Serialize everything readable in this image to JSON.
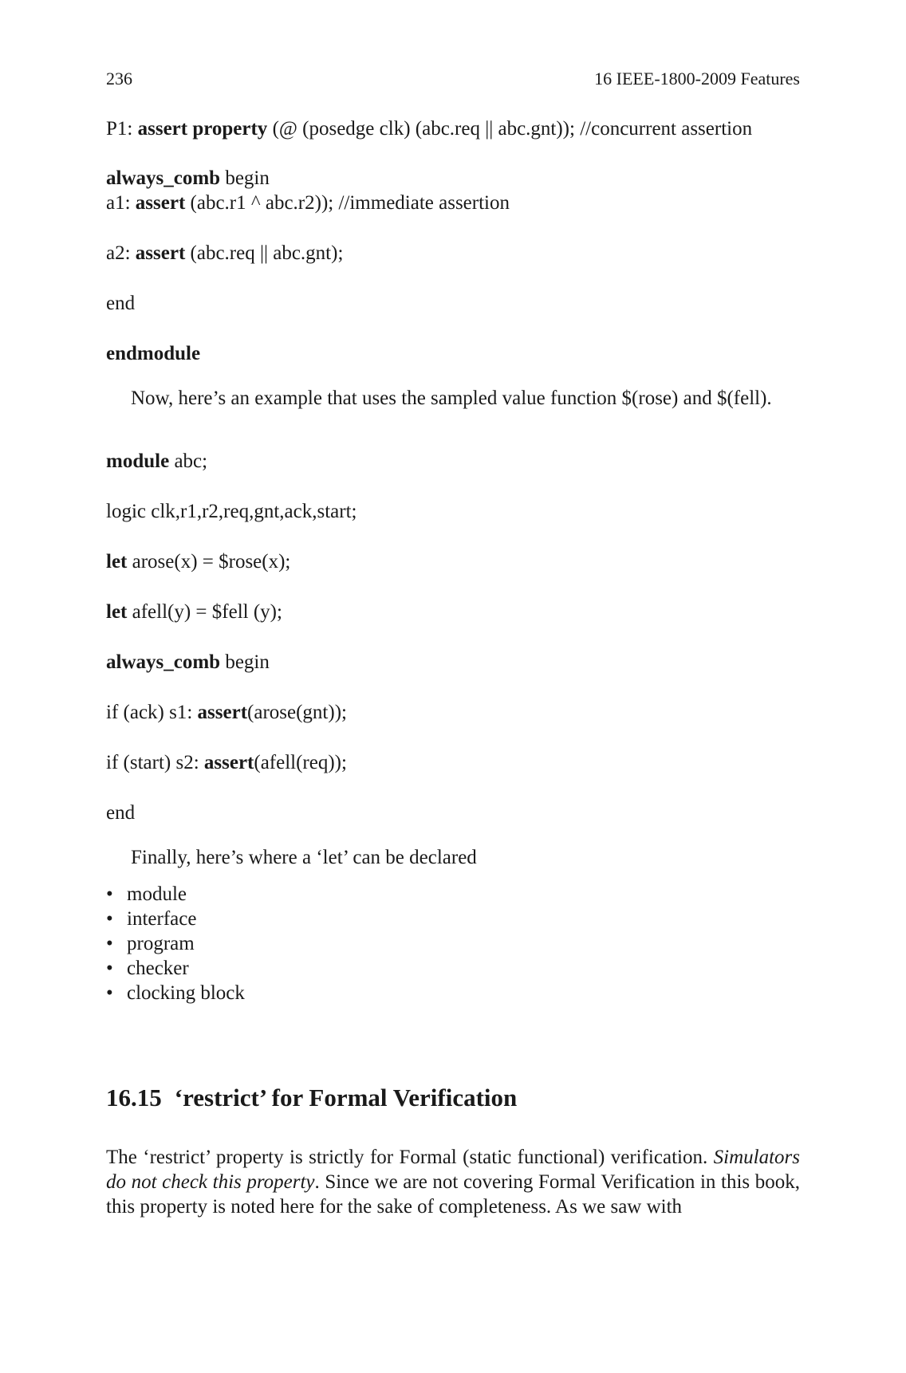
{
  "header": {
    "page_number": "236",
    "chapter": "16   IEEE-1800-2009 Features"
  },
  "code1": {
    "p1_label": "P1: ",
    "p1_kw": "assert property",
    "p1_rest": " (@ (posedge clk) (abc.req || abc.gnt)); //concurrent assertion",
    "always_kw": "always_comb",
    "always_rest": " begin",
    "a1_label": "a1: ",
    "a1_kw": "assert",
    "a1_rest": " (abc.r1 ^ abc.r2)); //immediate assertion",
    "a2_label": "a2: ",
    "a2_kw": "assert",
    "a2_rest": " (abc.req || abc.gnt);",
    "end": "end",
    "endmodule": "endmodule"
  },
  "intro_paragraph": "Now, here’s an example that uses the sampled value function $(rose) and $(fell).",
  "code2": {
    "module_kw": "module",
    "module_rest": " abc;",
    "logic_line": "logic clk,r1,r2,req,gnt,ack,start;",
    "let1_kw": "let",
    "let1_rest": " arose(x) = $rose(x);",
    "let2_kw": "let",
    "let2_rest": " afell(y) = $fell (y);",
    "always_kw": "always_comb",
    "always_rest": " begin",
    "s1_pre": "if (ack) s1: ",
    "s1_kw": "assert",
    "s1_rest": "(arose(gnt));",
    "s2_pre": "if (start) s2: ",
    "s2_kw": "assert",
    "s2_rest": "(afell(req));",
    "end": "end"
  },
  "let_intro": "Finally, here’s where a ‘let’ can be declared",
  "let_locations": [
    "module",
    "interface",
    "program",
    "checker",
    "clocking block"
  ],
  "section": {
    "number": "16.15",
    "title": "‘restrict’ for Formal Verification"
  },
  "section_body": {
    "part1": "The ‘restrict’ property is strictly for Formal (static functional) verification. ",
    "italic": "Simulators do not check this property",
    "part2": ". Since we are not covering Formal Verification in this book, this property is noted here for the sake of completeness. As we saw with"
  }
}
